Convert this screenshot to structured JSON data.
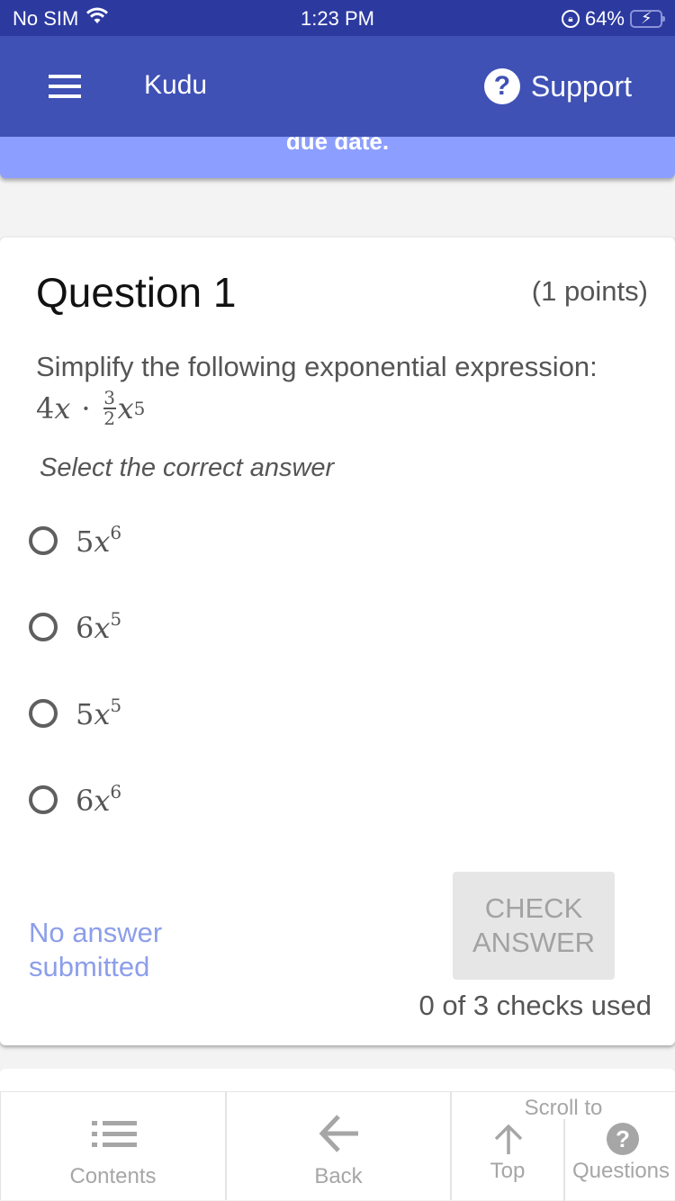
{
  "status_bar": {
    "carrier": "No SIM",
    "time": "1:23 PM",
    "battery_percent": "64%",
    "battery_level": 0.64,
    "icons": [
      "wifi-icon",
      "rotation-lock-icon",
      "battery-charging-icon"
    ]
  },
  "header": {
    "title": "Kudu",
    "support_label": "Support",
    "menu_icon": "hamburger-menu-icon",
    "support_icon": "question-circle-icon"
  },
  "banner": {
    "text": "due date."
  },
  "question": {
    "title": "Question 1",
    "points": "(1 points)",
    "prompt": "Simplify the following exponential expression:",
    "expression": {
      "coef": "4",
      "var": "x",
      "dot": "·",
      "frac_num": "3",
      "frac_den": "2",
      "var2": "x",
      "exp2": "5"
    },
    "instruction": "Select the correct answer",
    "options": [
      {
        "coef": "5",
        "var": "x",
        "exp": "6",
        "selected": false
      },
      {
        "coef": "6",
        "var": "x",
        "exp": "5",
        "selected": false
      },
      {
        "coef": "5",
        "var": "x",
        "exp": "5",
        "selected": false
      },
      {
        "coef": "6",
        "var": "x",
        "exp": "6",
        "selected": false
      }
    ],
    "status": "No answer submitted",
    "check_button_label": "CHECK ANSWER",
    "checks_used": "0 of 3 checks used"
  },
  "bottom_nav": {
    "contents_label": "Contents",
    "back_label": "Back",
    "scroll_to_label": "Scroll to",
    "top_label": "Top",
    "questions_label": "Questions"
  },
  "colors": {
    "status_bar": "#2c3aa0",
    "header": "#3f51b5",
    "banner": "#8c9eff",
    "status_text": "#8c9eea",
    "disabled_button": "#e6e6e6",
    "nav_gray": "#a6a6a6"
  }
}
